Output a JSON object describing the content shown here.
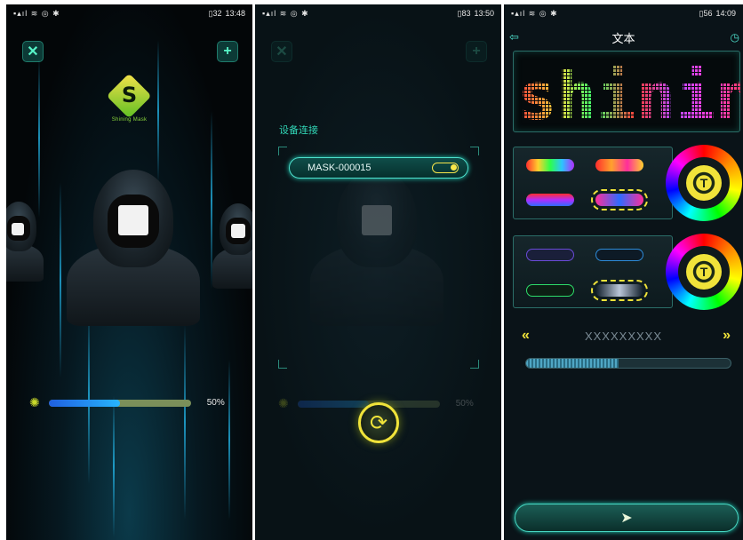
{
  "panel1": {
    "status": {
      "left": "▪▴ıl ≋ ◎ ✱",
      "battery": "32",
      "time": "13:48"
    },
    "settings_icon": "wrench-icon",
    "add_icon": "plus-icon",
    "logo_letter": "S",
    "logo_text": "Shining Mask",
    "brightness_percent": 50,
    "brightness_label": "50%"
  },
  "panel2": {
    "status": {
      "left": "▪▴ıl ≋ ◎ ✱",
      "battery": "83",
      "time": "13:50"
    },
    "title": "设备连接",
    "device_name": "MASK-000015",
    "device_connected": true,
    "brightness_label": "50%",
    "refresh_icon": "refresh-icon"
  },
  "panel3": {
    "status": {
      "left": "▪▴ıl ≋ ◎ ✱",
      "battery": "56",
      "time": "14:09"
    },
    "title": "文本",
    "led_text": "shinin",
    "preset_name": "XXXXXXXXX",
    "left_chevron": "«",
    "right_chevron": "»",
    "speed_percent": 45,
    "wheel_button_label": "T",
    "send_icon": "send-icon",
    "colors": {
      "accent": "#4fe3cf",
      "yellow": "#f0e33a"
    }
  }
}
